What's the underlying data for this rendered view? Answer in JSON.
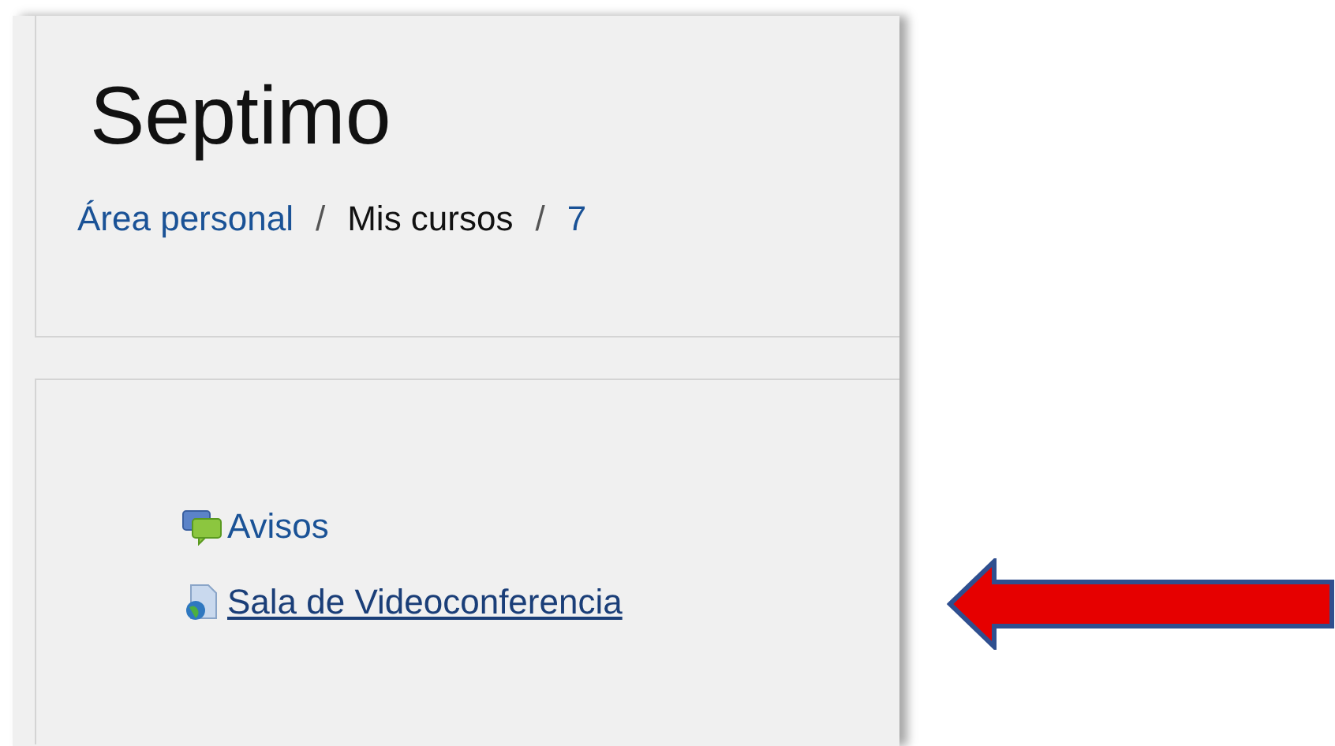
{
  "header": {
    "title": "Septimo",
    "breadcrumb": [
      {
        "label": "Área personal",
        "kind": "link"
      },
      {
        "label": "Mis cursos",
        "kind": "text"
      },
      {
        "label": "7",
        "kind": "link"
      }
    ],
    "separator": "/"
  },
  "activities": [
    {
      "label": "Avisos",
      "kind": "forum",
      "hovered": false
    },
    {
      "label": "Sala de Videoconferencia",
      "kind": "url",
      "hovered": true
    }
  ],
  "annotation": {
    "kind": "arrow"
  }
}
